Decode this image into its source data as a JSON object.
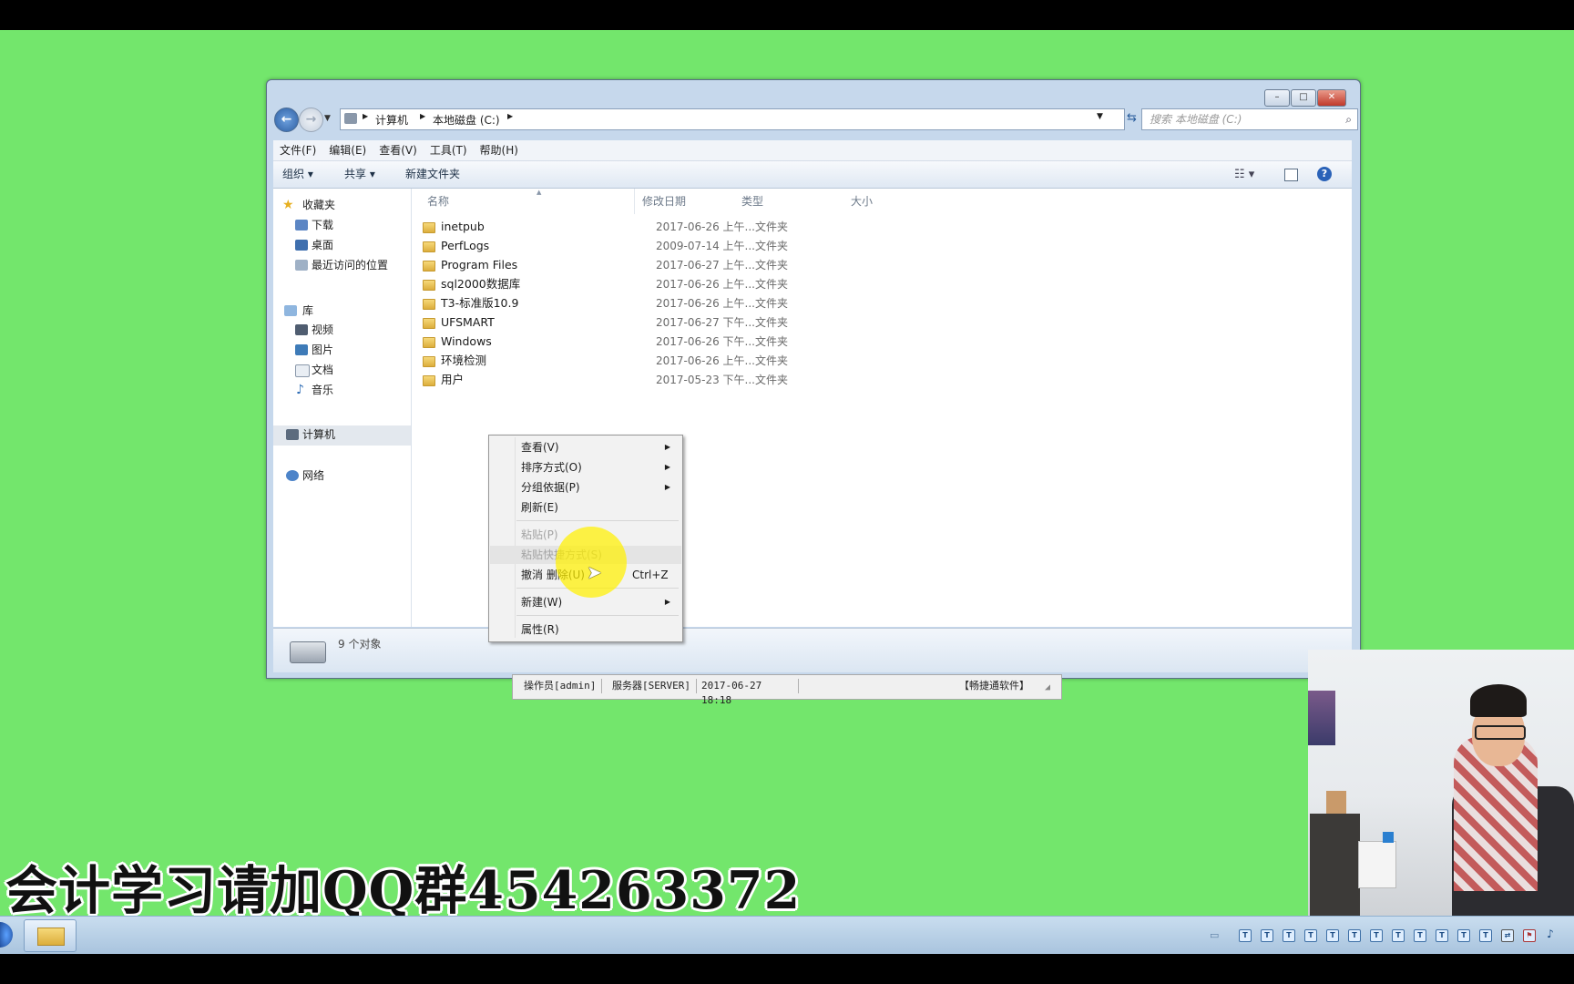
{
  "window": {
    "address_crumbs": [
      "计算机",
      "本地磁盘 (C:)"
    ],
    "search_placeholder": "搜索 本地磁盘 (C:)",
    "menubar": [
      "文件(F)",
      "编辑(E)",
      "查看(V)",
      "工具(T)",
      "帮助(H)"
    ],
    "toolbar": {
      "organize": "组织 ▾",
      "share": "共享 ▾",
      "new_folder": "新建文件夹"
    },
    "nav": {
      "favorites": "收藏夹",
      "downloads": "下载",
      "desktop": "桌面",
      "recent": "最近访问的位置",
      "libraries": "库",
      "videos": "视频",
      "pictures": "图片",
      "documents": "文档",
      "music": "音乐",
      "computer": "计算机",
      "network": "网络"
    },
    "columns": {
      "name": "名称",
      "modified": "修改日期",
      "type": "类型",
      "size": "大小"
    },
    "files": [
      {
        "name": "inetpub",
        "date": "2017-06-26 上午...",
        "type": "文件夹"
      },
      {
        "name": "PerfLogs",
        "date": "2009-07-14 上午...",
        "type": "文件夹"
      },
      {
        "name": "Program Files",
        "date": "2017-06-27 上午...",
        "type": "文件夹"
      },
      {
        "name": "sql2000数据库",
        "date": "2017-06-26 上午...",
        "type": "文件夹"
      },
      {
        "name": "T3-标准版10.9",
        "date": "2017-06-26 上午...",
        "type": "文件夹"
      },
      {
        "name": "UFSMART",
        "date": "2017-06-27 下午...",
        "type": "文件夹"
      },
      {
        "name": "Windows",
        "date": "2017-06-26 下午...",
        "type": "文件夹"
      },
      {
        "name": "环境检测",
        "date": "2017-06-26 上午...",
        "type": "文件夹"
      },
      {
        "name": "用户",
        "date": "2017-05-23 下午...",
        "type": "文件夹"
      }
    ],
    "status": "9 个对象"
  },
  "context_menu": {
    "view": "查看(V)",
    "sort_by": "排序方式(O)",
    "group_by": "分组依据(P)",
    "refresh": "刷新(E)",
    "paste": "粘贴(P)",
    "paste_shortcut": "粘贴快捷方式(S)",
    "undo_delete": "撤消 删除(U)",
    "undo_shortcut": "Ctrl+Z",
    "new": "新建(W)",
    "properties": "属性(R)"
  },
  "app_status": {
    "operator": "操作员[admin]",
    "server": "服务器[SERVER]",
    "datetime": "2017-06-27 18:18",
    "brand": "【畅捷通软件】"
  },
  "watermark": "会计学习请加QQ群454263372"
}
